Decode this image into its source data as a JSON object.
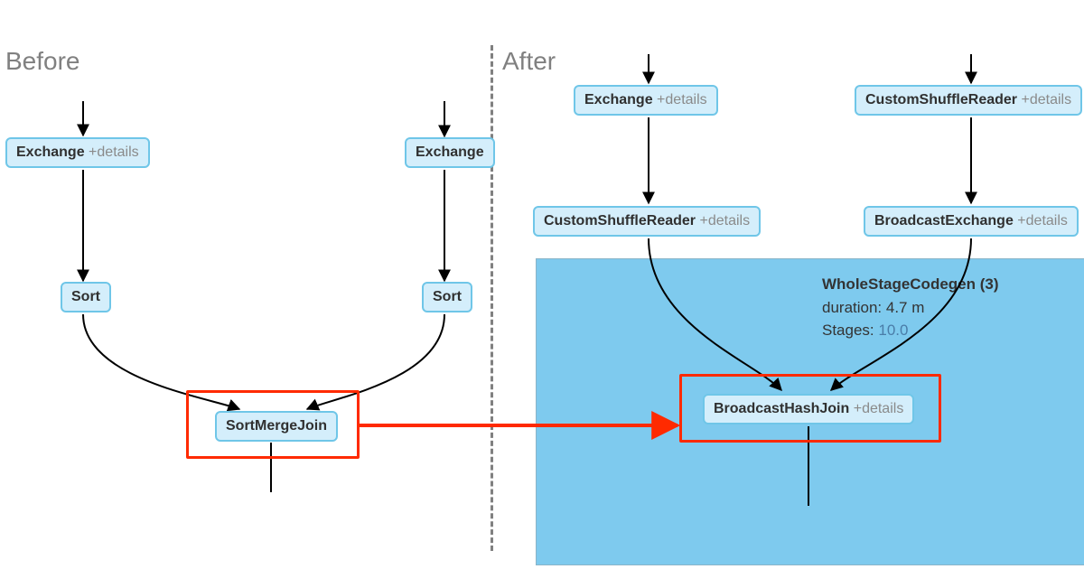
{
  "sections": {
    "before": {
      "title": "Before"
    },
    "after": {
      "title": "After"
    }
  },
  "before": {
    "exchange_left": {
      "label": "Exchange",
      "details": "+details"
    },
    "exchange_right": {
      "label": "Exchange"
    },
    "sort_left": {
      "label": "Sort"
    },
    "sort_right": {
      "label": "Sort"
    },
    "join": {
      "label": "SortMergeJoin"
    }
  },
  "after": {
    "exchange": {
      "label": "Exchange",
      "details": "+details"
    },
    "csr_top": {
      "label": "CustomShuffleReader",
      "details": "+details"
    },
    "csr_left": {
      "label": "CustomShuffleReader",
      "details": "+details"
    },
    "bcast_exch": {
      "label": "BroadcastExchange",
      "details": "+details"
    },
    "join": {
      "label": "BroadcastHashJoin",
      "details": "+details"
    },
    "stage": {
      "title": "WholeStageCodegen (3)",
      "duration_label": "duration: 4.7 m",
      "stages_label": "Stages: ",
      "stages_value": "10.0"
    }
  }
}
